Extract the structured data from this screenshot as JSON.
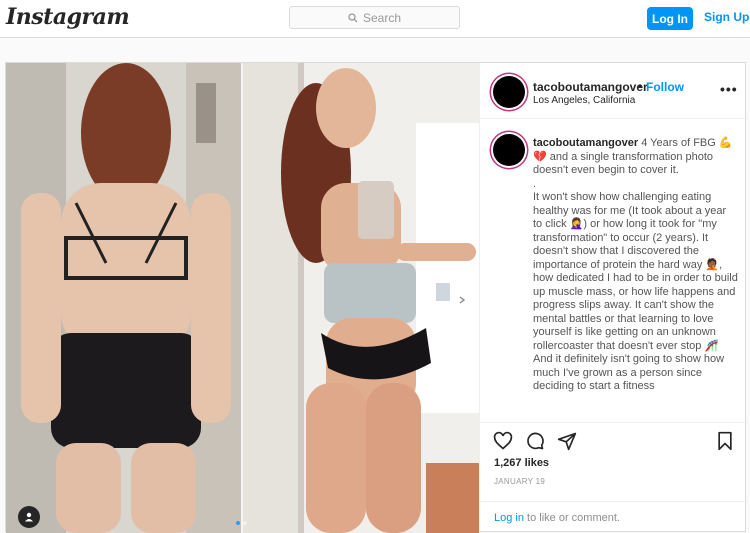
{
  "topbar": {
    "logo": "Instagram",
    "search_placeholder": "Search",
    "login_label": "Log In",
    "signup_label": "Sign Up"
  },
  "post": {
    "username": "tacoboutamangover",
    "follow_label": "Follow",
    "separator": "•",
    "location": "Los Angeles, California",
    "more_label": "•••",
    "caption_username": "tacoboutamangover",
    "caption_lines": [
      "4 Years of FBG 💪💔 and a single transformation photo doesn't even begin to cover it.",
      ".",
      "It won't show how challenging eating healthy was for me (It took about a year to click 🤦‍♀️) or how long it took for \"my transformation\" to occur (2 years). It doesn't show that I discovered the importance of protein the hard way 🤦🏾, how dedicated I had to be in order to build up muscle mass, or how life happens and progress slips away. It can't show the mental battles or that learning to love yourself is like getting on an unknown rollercoaster that doesn't ever stop 🎢 And it definitely isn't going to show how much I've grown as a person since deciding to start a fitness"
    ],
    "likes": "1,267 likes",
    "date": "JANUARY 19",
    "login_prompt_link": "Log in",
    "login_prompt_rest": " to like or comment."
  },
  "media": {
    "slide_count": 2,
    "active_slide": 1
  }
}
